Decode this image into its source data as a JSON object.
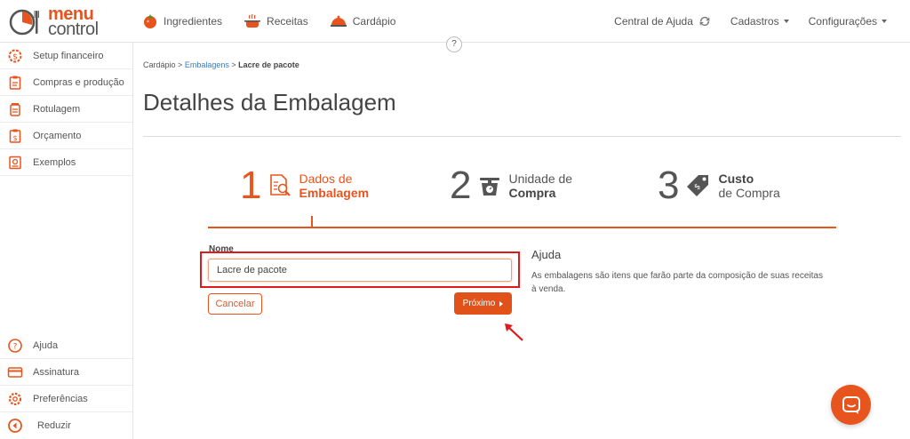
{
  "brand": {
    "logo_word1": "menu",
    "logo_word2": "control",
    "accent": "#e8541e"
  },
  "nav": {
    "main": [
      {
        "label": "Ingredientes",
        "icon": "tomato-icon"
      },
      {
        "label": "Receitas",
        "icon": "cooking-pot-icon"
      },
      {
        "label": "Cardápio",
        "icon": "cloche-icon"
      }
    ],
    "right": [
      {
        "label": "Central de Ajuda",
        "icon": "sync-icon"
      },
      {
        "label": "Cadastros"
      },
      {
        "label": "Configurações"
      }
    ],
    "help_toggle": "?"
  },
  "sidebar": {
    "items": [
      {
        "label": "Setup financeiro",
        "icon": "gear-dollar-icon"
      },
      {
        "label": "Compras e produção",
        "icon": "clipboard-icon"
      },
      {
        "label": "Rotulagem",
        "icon": "jar-icon"
      },
      {
        "label": "Orçamento",
        "icon": "clipboard-dollar-icon"
      },
      {
        "label": "Exemplos",
        "icon": "recipe-card-icon"
      }
    ],
    "bottom": [
      {
        "label": "Ajuda",
        "icon": "question-circle-icon"
      },
      {
        "label": "Assinatura",
        "icon": "credit-card-icon"
      },
      {
        "label": "Preferências",
        "icon": "gear-icon"
      },
      {
        "label": "Reduzir",
        "icon": "collapse-left-icon"
      }
    ]
  },
  "breadcrumb": {
    "root": "Cardápio",
    "sep": ">",
    "parent": "Embalagens",
    "current": "Lacre de pacote"
  },
  "page": {
    "title": "Detalhes da Embalagem"
  },
  "steps": [
    {
      "num": "1",
      "line1": "Dados de",
      "line2": "Embalagem",
      "icon": "document-search-icon",
      "active": true
    },
    {
      "num": "2",
      "line1": "Unidade de",
      "line2": "Compra",
      "icon": "scale-icon",
      "active": false
    },
    {
      "num": "3",
      "line1": "Custo",
      "line2": "de Compra",
      "icon": "price-tag-icon",
      "active": false
    }
  ],
  "form": {
    "name_label": "Nome",
    "name_value": "Lacre de pacote",
    "cancel_label": "Cancelar",
    "next_label": "Próximo"
  },
  "help": {
    "title": "Ajuda",
    "text": "As embalagens são itens que farão parte da composição de suas receitas à venda."
  }
}
